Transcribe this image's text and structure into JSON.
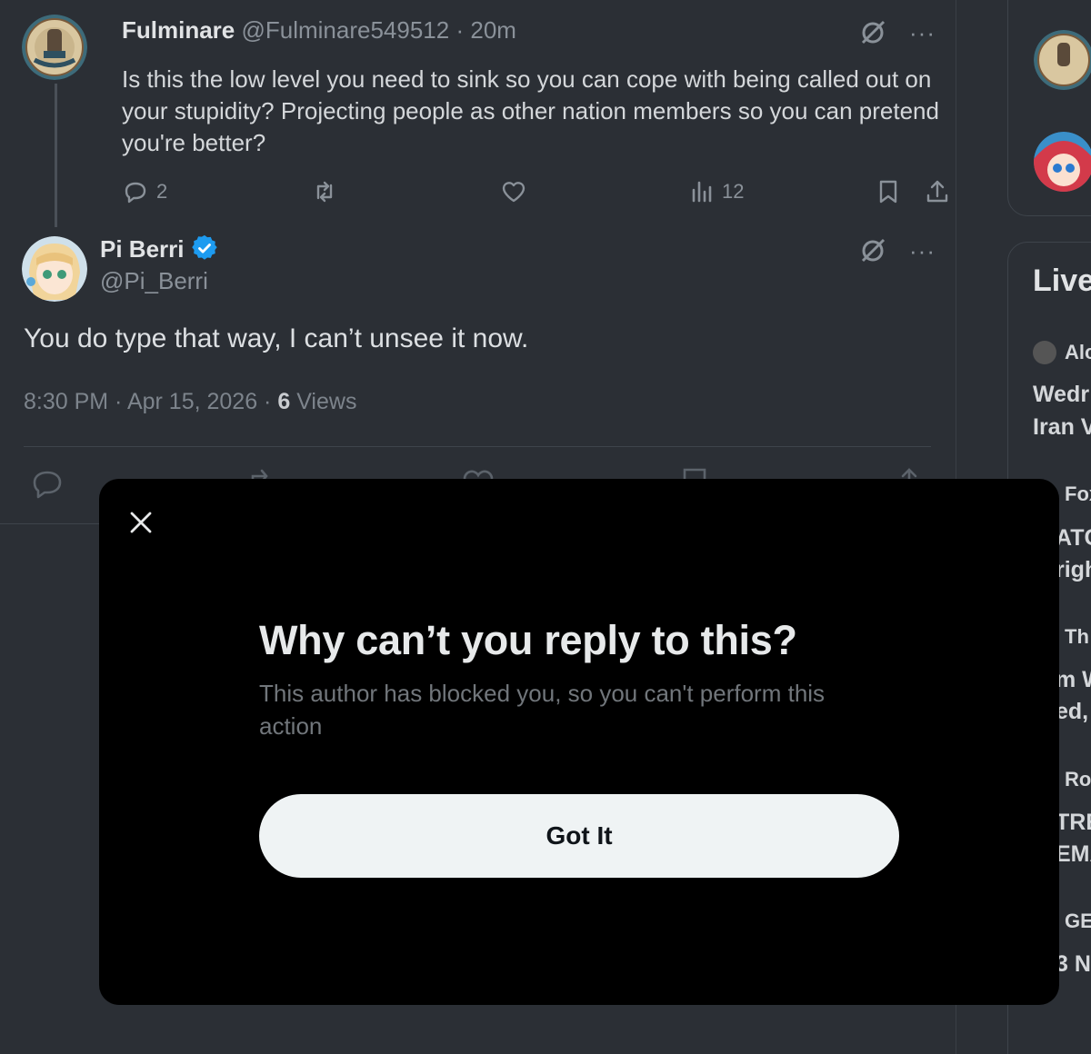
{
  "parent_tweet": {
    "display_name": "Fulminare",
    "handle": "@Fulminare549512",
    "separator": "·",
    "time": "20m",
    "text": "Is this the low level you need to sink so you can cope with being called out on your stupidity? Projecting people as other nation members so you can pretend you're better?",
    "reply_count": "2",
    "view_count": "12",
    "more_label": "···"
  },
  "main_tweet": {
    "display_name": "Pi Berri",
    "handle": "@Pi_Berri",
    "text": "You do type that way, I can’t unsee it now.",
    "timestamp": "8:30 PM · Apr 15, 2026 ·",
    "views_number": "6",
    "views_label": "Views",
    "more_label": "···"
  },
  "sidebar": {
    "live_title": "Live",
    "snippets": [
      {
        "label": "Alc"
      },
      {
        "label": "Wedr"
      },
      {
        "label": "Iran V"
      },
      {
        "label": "Fox"
      },
      {
        "label": "ATC"
      },
      {
        "label": "righ"
      },
      {
        "label": "Th"
      },
      {
        "label": "m W"
      },
      {
        "label": "ed,"
      },
      {
        "label": "Ro"
      },
      {
        "label": "TRE"
      },
      {
        "label": "EMA"
      },
      {
        "label": "GE"
      },
      {
        "label": "3 N"
      }
    ]
  },
  "modal": {
    "title": "Why can’t you reply to this?",
    "description": "This author has blocked you, so you can't perform this action",
    "button_label": "Got It"
  },
  "colors": {
    "background": "#2b2f35",
    "modal_background": "#000000",
    "button_background": "#eff3f4",
    "verified_blue": "#1d9bf0",
    "muted_text": "#8a9199"
  }
}
